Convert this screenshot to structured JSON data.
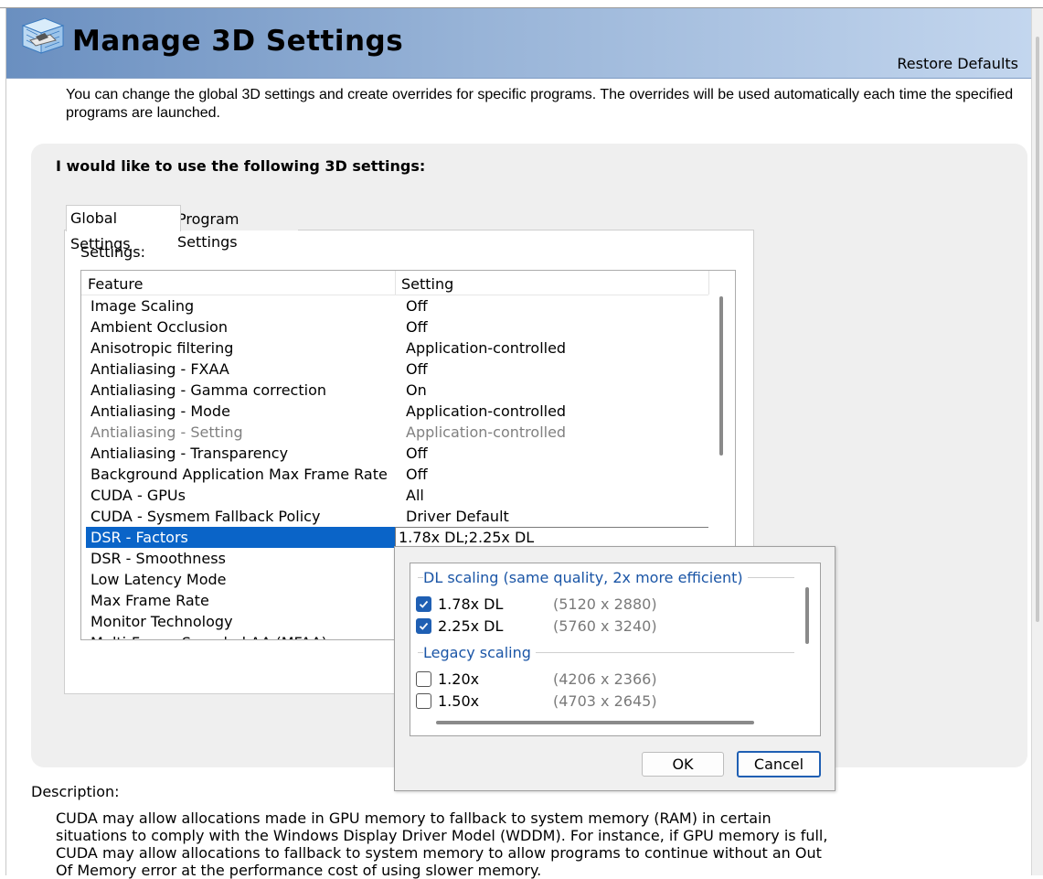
{
  "header": {
    "title": "Manage 3D Settings",
    "restore_defaults": "Restore Defaults"
  },
  "intro": "You can change the global 3D settings and create overrides for specific programs. The overrides will be used automatically each time the specified programs are launched.",
  "panel": {
    "heading": "I would like to use the following 3D settings:",
    "tabs": [
      {
        "label": "Global Settings",
        "active": true
      },
      {
        "label": "Program Settings",
        "active": false
      }
    ],
    "settings_label": "Settings:",
    "columns": {
      "feature": "Feature",
      "setting": "Setting"
    },
    "rows": [
      {
        "feature": "Image Scaling",
        "setting": "Off"
      },
      {
        "feature": "Ambient Occlusion",
        "setting": "Off"
      },
      {
        "feature": "Anisotropic filtering",
        "setting": "Application-controlled"
      },
      {
        "feature": "Antialiasing - FXAA",
        "setting": "Off"
      },
      {
        "feature": "Antialiasing - Gamma correction",
        "setting": "On"
      },
      {
        "feature": "Antialiasing - Mode",
        "setting": "Application-controlled"
      },
      {
        "feature": "Antialiasing - Setting",
        "setting": "Application-controlled",
        "disabled": true
      },
      {
        "feature": "Antialiasing - Transparency",
        "setting": "Off"
      },
      {
        "feature": "Background Application Max Frame Rate",
        "setting": "Off"
      },
      {
        "feature": "CUDA - GPUs",
        "setting": "All"
      },
      {
        "feature": "CUDA - Sysmem Fallback Policy",
        "setting": "Driver Default"
      },
      {
        "feature": "DSR - Factors",
        "setting": "1.78x DL;2.25x DL",
        "selected": true
      },
      {
        "feature": "DSR - Smoothness",
        "setting": ""
      },
      {
        "feature": "Low Latency Mode",
        "setting": ""
      },
      {
        "feature": "Max Frame Rate",
        "setting": ""
      },
      {
        "feature": "Monitor Technology",
        "setting": ""
      },
      {
        "feature": "Multi-Frame Sampled AA (MFAA)",
        "setting": ""
      }
    ]
  },
  "dsr_popup": {
    "groups": [
      {
        "title": "DL scaling (same quality, 2x more efficient)",
        "options": [
          {
            "label": "1.78x DL",
            "resolution": "(5120 x 2880)",
            "checked": true
          },
          {
            "label": "2.25x DL",
            "resolution": "(5760 x 3240)",
            "checked": true
          }
        ]
      },
      {
        "title": "Legacy scaling",
        "options": [
          {
            "label": "1.20x",
            "resolution": "(4206 x 2366)",
            "checked": false
          },
          {
            "label": "1.50x",
            "resolution": "(4703 x 2645)",
            "checked": false
          }
        ]
      }
    ],
    "ok_label": "OK",
    "cancel_label": "Cancel"
  },
  "description": {
    "label": "Description:",
    "text": "CUDA may allow allocations made in GPU memory to fallback to system memory (RAM) in certain situations to comply with the Windows Display Driver Model (WDDM). For instance, if GPU memory is full, CUDA may allow allocations to fallback to system memory to allow programs to continue without an Out Of Memory error at the performance cost of using slower memory."
  },
  "colors": {
    "selection": "#0a64c8",
    "group_title": "#1a55a6",
    "checkbox_checked": "#1f5fb3"
  }
}
